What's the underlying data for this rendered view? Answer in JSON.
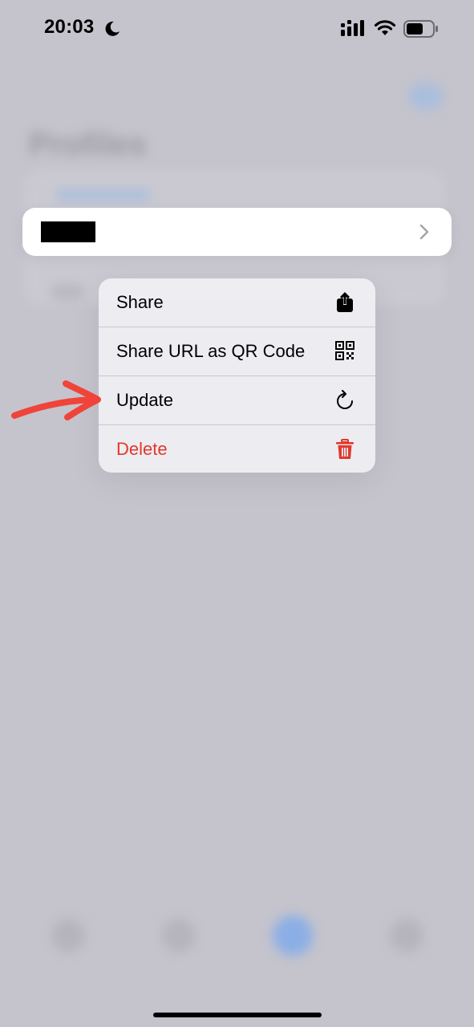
{
  "status_bar": {
    "time": "20:03",
    "focus_icon": "moon-icon",
    "signal_icon": "cellular-signal-icon",
    "wifi_icon": "wifi-icon",
    "battery_icon": "battery-icon",
    "battery_level": 0.6
  },
  "background": {
    "title": "Profiles",
    "blurred": true
  },
  "profile_row": {
    "name_redacted": true,
    "chevron_icon": "chevron-right-icon"
  },
  "context_menu": {
    "items": [
      {
        "label": "Share",
        "icon": "share-icon"
      },
      {
        "label": "Share URL as QR Code",
        "icon": "qr-code-icon"
      },
      {
        "label": "Update",
        "icon": "refresh-icon"
      },
      {
        "label": "Delete",
        "icon": "trash-icon",
        "destructive": true
      }
    ]
  },
  "annotation": {
    "icon": "red-arrow-icon",
    "color": "#f0443a",
    "points_to": "Update"
  },
  "colors": {
    "destructive": "#e0392c",
    "accent": "#8aaee6"
  }
}
